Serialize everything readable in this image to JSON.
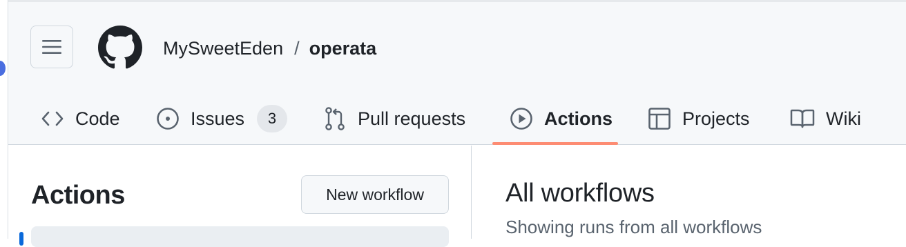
{
  "repo": {
    "owner": "MySweetEden",
    "separator": "/",
    "name": "operata"
  },
  "tabs": [
    {
      "label": "Code",
      "icon": "code-icon"
    },
    {
      "label": "Issues",
      "icon": "issue-icon",
      "count": "3"
    },
    {
      "label": "Pull requests",
      "icon": "pull-request-icon"
    },
    {
      "label": "Actions",
      "icon": "play-icon",
      "active": true
    },
    {
      "label": "Projects",
      "icon": "table-icon"
    },
    {
      "label": "Wiki",
      "icon": "book-icon"
    }
  ],
  "sidebar": {
    "title": "Actions",
    "new_workflow_label": "New workflow"
  },
  "main": {
    "title": "All workflows",
    "subtitle": "Showing runs from all workflows"
  },
  "colors": {
    "active_underline": "#fd8c73",
    "header_bg": "#f6f8fa",
    "text": "#1f2328",
    "muted": "#59636e"
  }
}
